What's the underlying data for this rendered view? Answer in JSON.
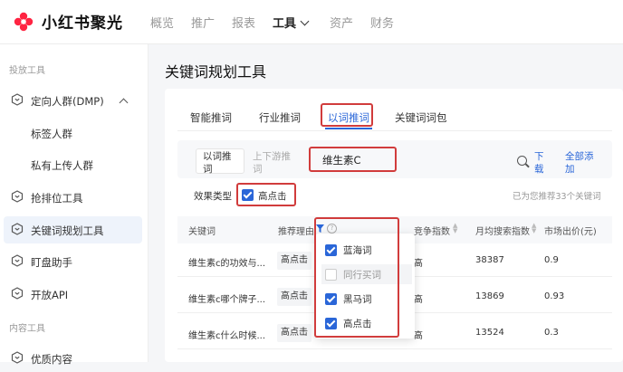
{
  "app": {
    "name": "小红书聚光"
  },
  "nav": {
    "items": [
      "概览",
      "推广",
      "报表",
      "工具",
      "资产",
      "财务"
    ],
    "active": "工具"
  },
  "sidebar": {
    "section1": "投放工具",
    "dmp": "定向人群(DMP)",
    "dmp_children": [
      "标签人群",
      "私有上传人群"
    ],
    "items": [
      "抢排位工具",
      "关键词规划工具",
      "盯盘助手",
      "开放API"
    ],
    "active": "关键词规划工具",
    "section2": "内容工具",
    "quality": "优质内容"
  },
  "page": {
    "title": "关键词规划工具"
  },
  "tabs": {
    "items": [
      "智能推词",
      "行业推词",
      "以词推词",
      "关键词词包"
    ],
    "active": "以词推词"
  },
  "query": {
    "mode_active": "以词推词",
    "mode_other": "上下游推词",
    "keyword": "维生素C",
    "download": "下载",
    "expand_all": "全部添加"
  },
  "filter": {
    "label": "效果类型",
    "option": "高点击",
    "checked": true,
    "recommend_count": "已为您推荐33个关键词"
  },
  "table": {
    "headers": [
      "关键词",
      "推荐理由",
      "竞争指数",
      "月均搜索指数",
      "市场出价(元)"
    ],
    "rows": [
      {
        "keyword": "维生素c的功效与...",
        "reason": "高点击",
        "competition": "高",
        "monthly": "38387",
        "price": "0.9"
      },
      {
        "keyword": "维生素c哪个牌子...",
        "reason": "高点击",
        "competition": "高",
        "monthly": "13869",
        "price": "0.93"
      },
      {
        "keyword": "维生素c什么时候...",
        "reason": "高点击",
        "competition": "高",
        "monthly": "13524",
        "price": "0.3"
      }
    ]
  },
  "reason_dropdown": {
    "options": [
      {
        "label": "蓝海词",
        "checked": true
      },
      {
        "label": "同行买词",
        "checked": false
      },
      {
        "label": "黑马词",
        "checked": true
      },
      {
        "label": "高点击",
        "checked": true
      }
    ]
  },
  "colors": {
    "accent": "#2a66d8",
    "highlight": "#d13c3c",
    "logo": "#ff2442"
  }
}
